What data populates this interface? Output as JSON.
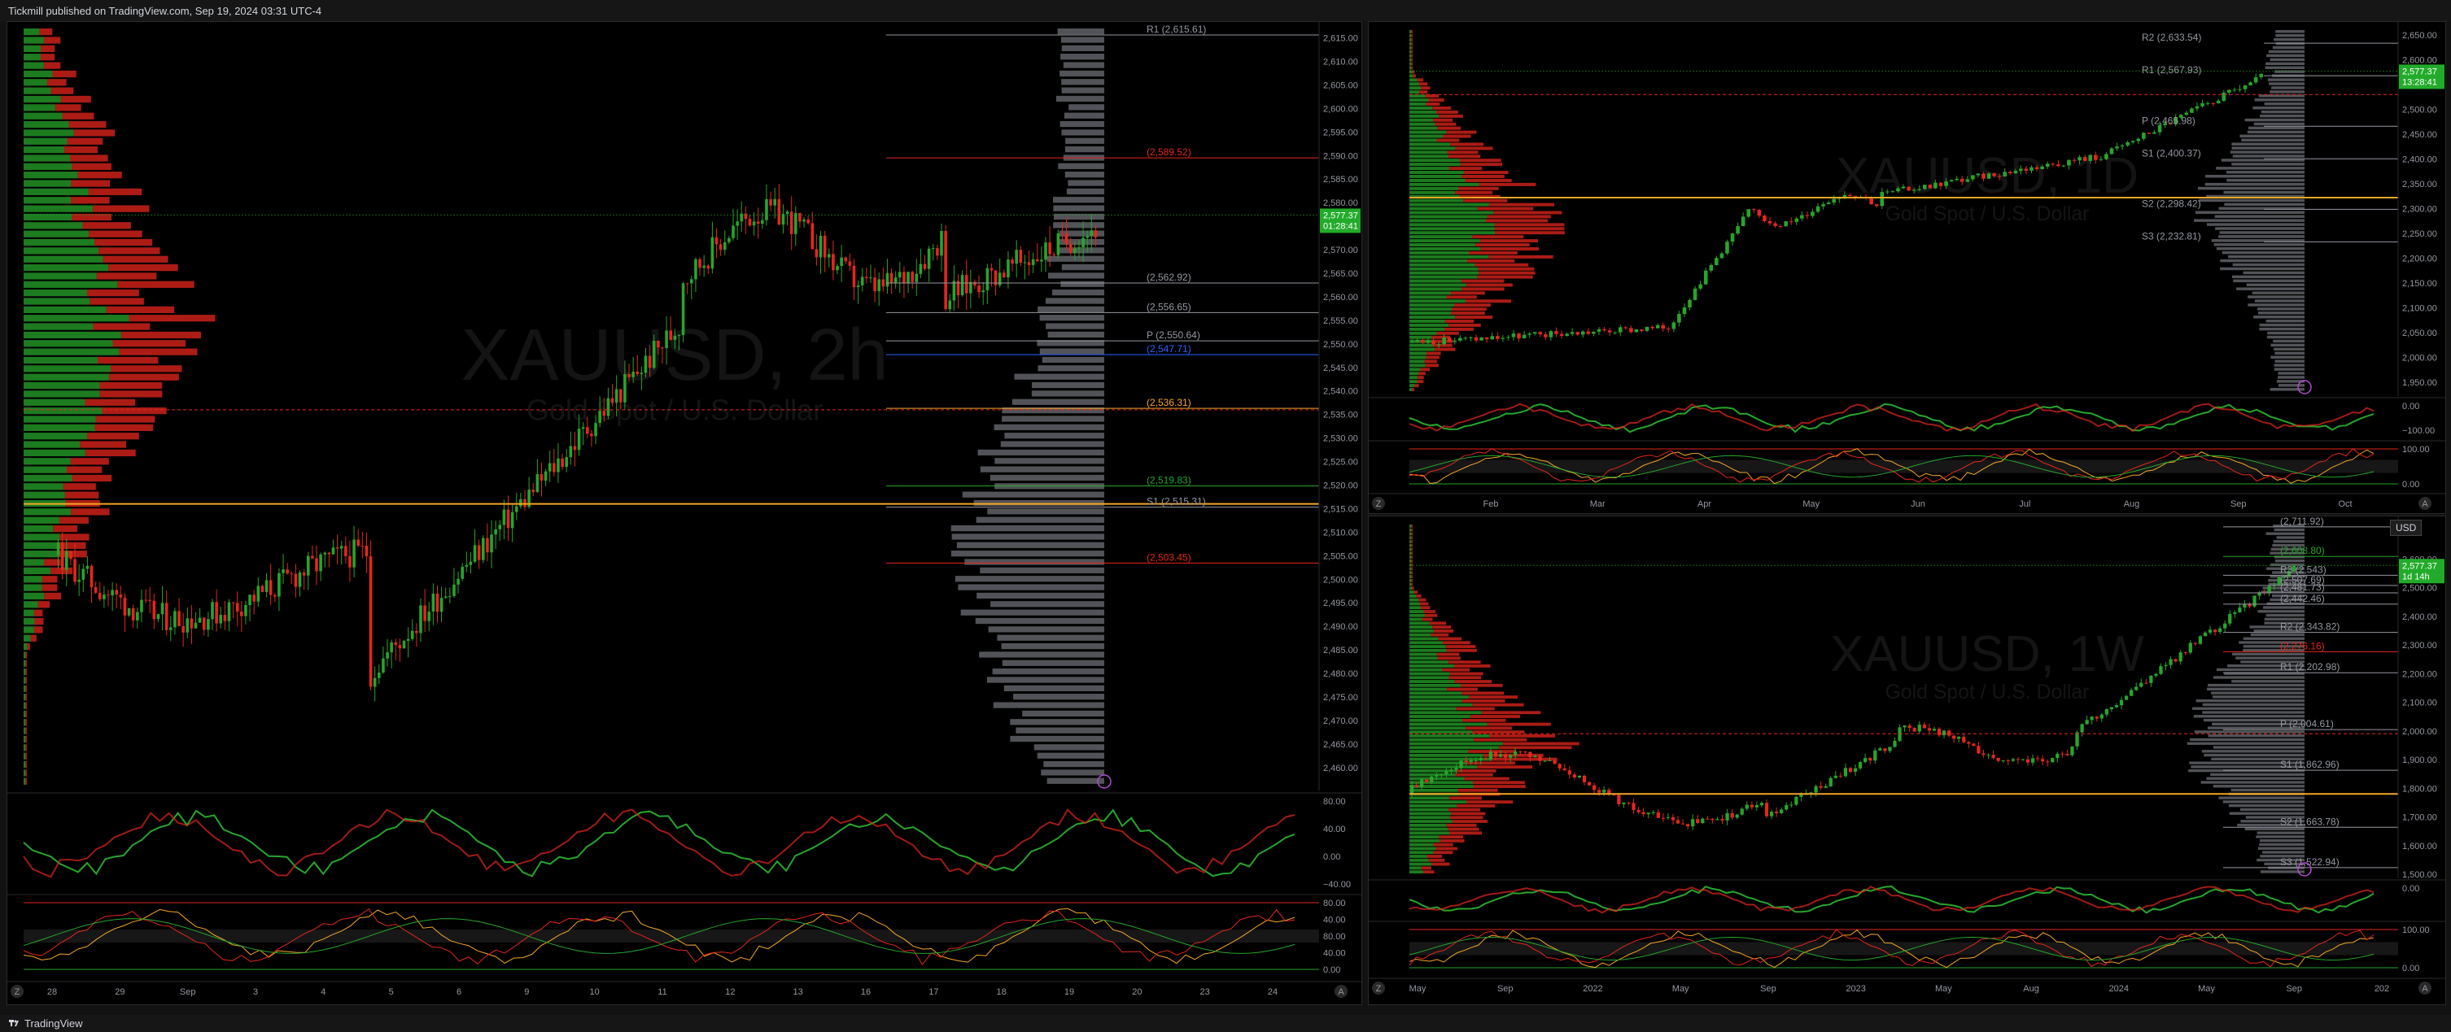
{
  "header": {
    "text": "Tickmill published on TradingView.com, Sep 19, 2024 03:31 UTC-4"
  },
  "footer": {
    "brand": "TradingView"
  },
  "colors": {
    "up": "#26a62a",
    "down": "#e5261c",
    "orange": "#f5a623",
    "blue": "#2962ff",
    "bg": "#000000"
  },
  "chart_2h": {
    "watermark_symbol": "XAUUSD, 2h",
    "watermark_name": "Gold Spot / U.S. Dollar",
    "price_ticks": [
      "2,615.00",
      "2,610.00",
      "2,605.00",
      "2,600.00",
      "2,595.00",
      "2,590.00",
      "2,585.00",
      "2,580.00",
      "2,575.00",
      "2,570.00",
      "2,565.00",
      "2,560.00",
      "2,555.00",
      "2,550.00",
      "2,545.00",
      "2,540.00",
      "2,535.00",
      "2,530.00",
      "2,525.00",
      "2,520.00",
      "2,515.00",
      "2,510.00",
      "2,505.00",
      "2,500.00",
      "2,495.00",
      "2,490.00",
      "2,485.00",
      "2,480.00",
      "2,475.00",
      "2,470.00",
      "2,465.00",
      "2,460.00"
    ],
    "price_tick_values": [
      2615,
      2610,
      2605,
      2600,
      2595,
      2590,
      2585,
      2580,
      2575,
      2570,
      2565,
      2560,
      2555,
      2550,
      2545,
      2540,
      2535,
      2530,
      2525,
      2520,
      2515,
      2510,
      2505,
      2500,
      2495,
      2490,
      2485,
      2480,
      2475,
      2470,
      2465,
      2460
    ],
    "current_price": "2,577.37",
    "countdown": "01:28:41",
    "levels": [
      {
        "label": "(2,589.52)",
        "value": 2589.52,
        "color": "#e5261c"
      },
      {
        "label": "(2,562.92)",
        "value": 2562.92,
        "color": "#9598a1"
      },
      {
        "label": "(2,556.65)",
        "value": 2556.65,
        "color": "#9598a1"
      },
      {
        "label": "P (2,550.64)",
        "value": 2550.64,
        "color": "#9598a1"
      },
      {
        "label": "(2,547.71)",
        "value": 2547.71,
        "color": "#2962ff"
      },
      {
        "label": "(2,536.31)",
        "value": 2536.31,
        "color": "#f5a623"
      },
      {
        "label": "(2,519.83)",
        "value": 2519.83,
        "color": "#26a62a"
      },
      {
        "label": "S1 (2,515.31)",
        "value": 2515.31,
        "color": "#9598a1"
      },
      {
        "label": "(2,503.45)",
        "value": 2503.45,
        "color": "#e5261c"
      },
      {
        "label": "R1 (2,615.61)",
        "value": 2615.61,
        "color": "#9598a1"
      }
    ],
    "time_ticks": [
      "28",
      "29",
      "Sep",
      "3",
      "4",
      "5",
      "6",
      "9",
      "10",
      "11",
      "12",
      "13",
      "16",
      "17",
      "18",
      "19",
      "20",
      "23",
      "24"
    ],
    "osc1_ticks": [
      "80.00",
      "40.00",
      "0.00",
      "−40.00"
    ],
    "osc2_ticks": [
      "80.00",
      "40.00",
      "80.00",
      "40.00",
      "0.00"
    ]
  },
  "chart_1d": {
    "watermark_symbol": "XAUUSD, 1D",
    "watermark_name": "Gold Spot / U.S. Dollar",
    "price_ticks": [
      "2,650.00",
      "2,600.00",
      "2,550.00",
      "2,500.00",
      "2,450.00",
      "2,400.00",
      "2,350.00",
      "2,300.00",
      "2,250.00",
      "2,200.00",
      "2,150.00",
      "2,100.00",
      "2,050.00",
      "2,000.00",
      "1,950.00"
    ],
    "price_tick_values": [
      2650,
      2600,
      2550,
      2500,
      2450,
      2400,
      2350,
      2300,
      2250,
      2200,
      2150,
      2100,
      2050,
      2000,
      1950
    ],
    "current_price": "2,577.37",
    "countdown": "13:28:41",
    "levels": [
      {
        "label": "R2 (2,633.54)",
        "value": 2633.54
      },
      {
        "label": "R1 (2,567.93)",
        "value": 2567.93
      },
      {
        "label": "P (2,465.98)",
        "value": 2465.98
      },
      {
        "label": "S1 (2,400.37)",
        "value": 2400.37
      },
      {
        "label": "S2 (2,298.42)",
        "value": 2298.42
      },
      {
        "label": "S3 (2,232.81)",
        "value": 2232.81
      }
    ],
    "time_ticks": [
      "Feb",
      "Mar",
      "Apr",
      "May",
      "Jun",
      "Jul",
      "Aug",
      "Sep",
      "Oct"
    ],
    "osc1_ticks": [
      "0.00",
      "−100.00"
    ],
    "osc2_ticks": [
      "100.00",
      "0.00"
    ]
  },
  "chart_1w": {
    "watermark_symbol": "XAUUSD, 1W",
    "watermark_name": "Gold Spot / U.S. Dollar",
    "currency": "USD",
    "price_ticks": [
      "2,600.00",
      "2,500.00",
      "2,400.00",
      "2,300.00",
      "2,200.00",
      "2,100.00",
      "2,000.00",
      "1,900.00",
      "1,800.00",
      "1,700.00",
      "1,600.00",
      "1,500.00"
    ],
    "price_tick_values": [
      2600,
      2500,
      2400,
      2300,
      2200,
      2100,
      2000,
      1900,
      1800,
      1700,
      1600,
      1500
    ],
    "current_price": "2,577.37",
    "countdown": "1d 14h",
    "levels": [
      {
        "label": "(2,711.92)",
        "value": 2711.92,
        "color": "#9598a1"
      },
      {
        "label": "(2,608.80)",
        "value": 2608.8,
        "color": "#26a62a"
      },
      {
        "label": "R3 (2,543)",
        "value": 2543.0,
        "color": "#9598a1"
      },
      {
        "label": "(2,507.69)",
        "value": 2507.69,
        "color": "#9598a1"
      },
      {
        "label": "(2,481.73)",
        "value": 2481.73,
        "color": "#9598a1"
      },
      {
        "label": "(2,442.46)",
        "value": 2442.46,
        "color": "#9598a1"
      },
      {
        "label": "R2 (2,343.82)",
        "value": 2343.82,
        "color": "#9598a1"
      },
      {
        "label": "(2,276.16)",
        "value": 2276.16,
        "color": "#e5261c"
      },
      {
        "label": "R1 (2,202.98)",
        "value": 2202.98,
        "color": "#9598a1"
      },
      {
        "label": "P (2,004.61)",
        "value": 2004.61,
        "color": "#9598a1"
      },
      {
        "label": "S1 (1,862.96)",
        "value": 1862.96,
        "color": "#9598a1"
      },
      {
        "label": "S2 (1,663.78)",
        "value": 1663.78,
        "color": "#9598a1"
      },
      {
        "label": "S3 (1,522.94)",
        "value": 1522.94,
        "color": "#9598a1"
      }
    ],
    "time_ticks": [
      "May",
      "Sep",
      "2022",
      "May",
      "Sep",
      "2023",
      "May",
      "Aug",
      "2024",
      "May",
      "Sep",
      "202"
    ],
    "osc1_ticks": [
      "0.00"
    ],
    "osc2_ticks": [
      "100.00",
      "0.00"
    ]
  }
}
